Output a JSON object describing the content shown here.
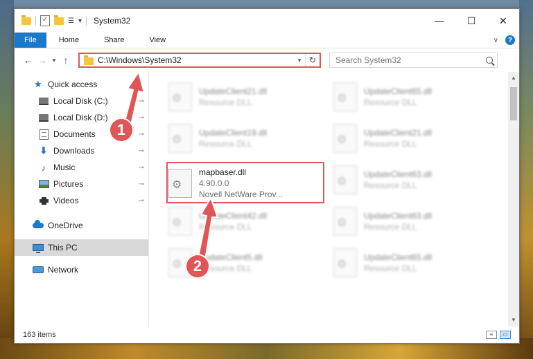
{
  "window": {
    "title": "System32",
    "qat_dropdown": "▾",
    "caption": {
      "minimize": "—",
      "maximize": "☐",
      "close": "✕"
    }
  },
  "ribbon": {
    "tabs": [
      "File",
      "Home",
      "Share",
      "View"
    ],
    "expand_glyph": "∨",
    "help_glyph": "?"
  },
  "navigation": {
    "back": "←",
    "forward": "→",
    "recent": "▾",
    "up": "↑",
    "address": "C:\\Windows\\System32",
    "address_dropdown": "▾",
    "refresh": "↻",
    "search_placeholder": "Search System32"
  },
  "sidebar": {
    "quick_access": "Quick access",
    "items": [
      {
        "label": "Local Disk (C:)",
        "icon": "drive-icon"
      },
      {
        "label": "Local Disk (D:)",
        "icon": "drive-icon"
      },
      {
        "label": "Documents",
        "icon": "documents-icon"
      },
      {
        "label": "Downloads",
        "icon": "downloads-icon"
      },
      {
        "label": "Music",
        "icon": "music-icon"
      },
      {
        "label": "Pictures",
        "icon": "pictures-icon"
      },
      {
        "label": "Videos",
        "icon": "videos-icon"
      }
    ],
    "pin_glyph": "📌",
    "onedrive": "OneDrive",
    "this_pc": "This PC",
    "network": "Network"
  },
  "files": [
    {
      "name": "UpdateClient21.dll",
      "sub": "Resource DLL"
    },
    {
      "name": "UpdateClient65.dll",
      "sub": "Resource DLL"
    },
    {
      "name": "UpdateClient19.dll",
      "sub": "Resource DLL"
    },
    {
      "name": "UpdateClient21.dll",
      "sub": "Resource DLL"
    },
    {
      "name": "mapbaser.dll",
      "sub": "4.90.0.0",
      "sub2": "Novell NetWare Prov..."
    },
    {
      "name": "UpdateClient63.dll",
      "sub": "Resource DLL"
    },
    {
      "name": "UpdateClient42.dll",
      "sub": "Resource DLL"
    },
    {
      "name": "UpdateClient63.dll",
      "sub": "Resource DLL"
    },
    {
      "name": "UpdateClient5.dll",
      "sub": "Resource DLL"
    },
    {
      "name": "UpdateClient65.dll",
      "sub": "Resource DLL"
    }
  ],
  "status": {
    "items_count": "163 items"
  },
  "callouts": {
    "step1": "1",
    "step2": "2"
  },
  "colors": {
    "accent": "#1979ca",
    "highlight": "#e05555"
  }
}
